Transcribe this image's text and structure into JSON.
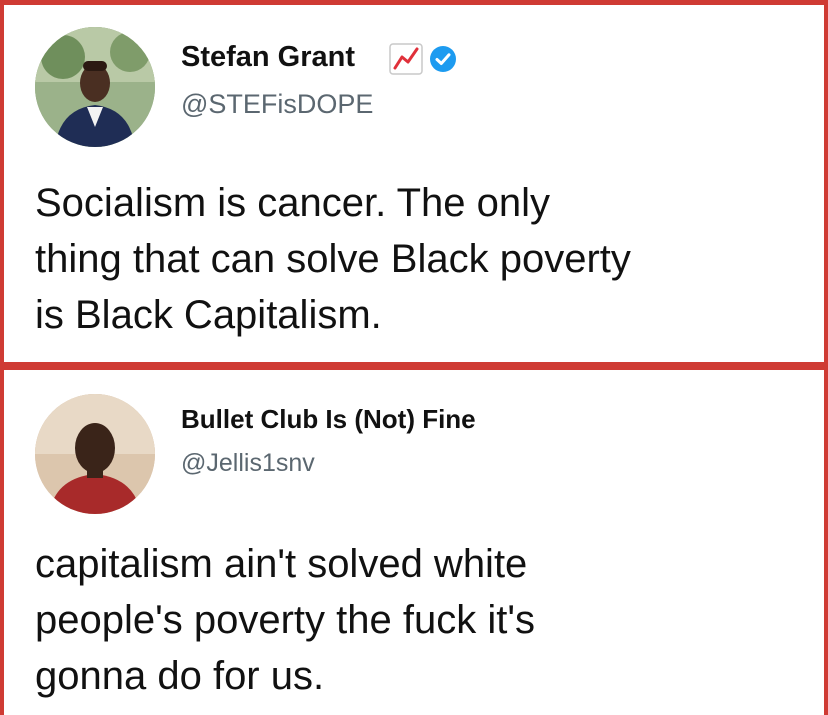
{
  "tweets": [
    {
      "display_name": "Stefan Grant",
      "handle": "@STEFisDOPE",
      "icons": [
        "chart-increasing-emoji-icon",
        "verified-badge-icon"
      ],
      "text": "Socialism is cancer. The only\nthing that can solve Black poverty\nis Black Capitalism."
    },
    {
      "display_name": "Bullet Club Is (Not) Fine",
      "handle": "@Jellis1snv",
      "icons": [],
      "text": "capitalism ain't solved white\npeople's poverty the fuck it's\ngonna do for us."
    }
  ],
  "colors": {
    "frame": "#cf3b34",
    "verified": "#1d9bf0",
    "handle": "#5b6770",
    "text": "#111111"
  }
}
